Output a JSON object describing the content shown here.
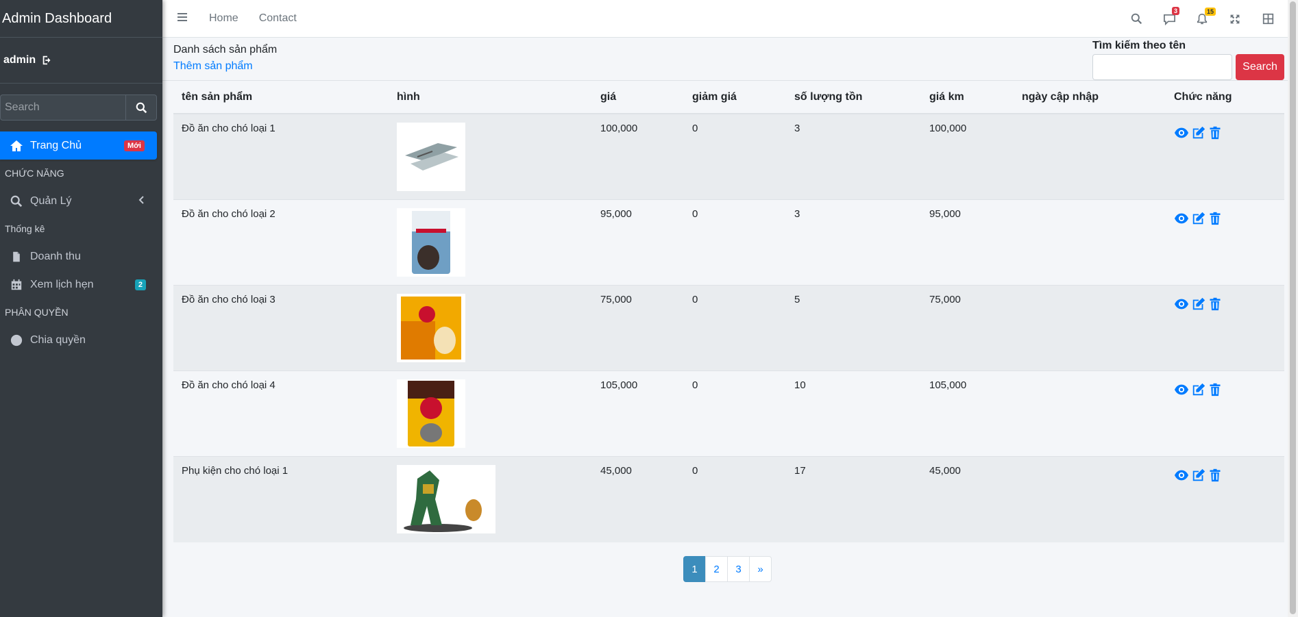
{
  "brand": "Admin Dashboard",
  "user": "admin",
  "sidebar_search_placeholder": "Search",
  "nav": {
    "home": "Trang Chủ",
    "home_badge": "Mới",
    "header_functions": "CHỨC NĂNG",
    "manage": "Quản Lý",
    "header_stats": "Thống kê",
    "revenue": "Doanh thu",
    "appointments": "Xem lịch hẹn",
    "appointments_badge": "2",
    "header_perm": "PHÂN QUYỀN",
    "perm": "Chia quyền"
  },
  "topnav": {
    "home": "Home",
    "contact": "Contact",
    "messages_count": "3",
    "notifications_count": "15"
  },
  "page": {
    "title": "Danh sách sản phẩm",
    "add_link": "Thêm sản phẩm",
    "search_label": "Tìm kiếm theo tên",
    "search_button": "Search"
  },
  "table": {
    "headers": [
      "tên sản phẩm",
      "hình",
      "giá",
      "giảm giá",
      "số lượng tồn",
      "giá km",
      "ngày cập nhập",
      "Chức năng"
    ],
    "rows": [
      {
        "name": "Đồ ăn cho chó loại 1",
        "price": "100,000",
        "discount": "0",
        "stock": "3",
        "sale_price": "100,000",
        "updated": ""
      },
      {
        "name": "Đồ ăn cho chó loại 2",
        "price": "95,000",
        "discount": "0",
        "stock": "3",
        "sale_price": "95,000",
        "updated": ""
      },
      {
        "name": "Đồ ăn cho chó loại 3",
        "price": "75,000",
        "discount": "0",
        "stock": "5",
        "sale_price": "75,000",
        "updated": ""
      },
      {
        "name": "Đồ ăn cho chó loại 4",
        "price": "105,000",
        "discount": "0",
        "stock": "10",
        "sale_price": "105,000",
        "updated": ""
      },
      {
        "name": "Phụ kiện cho chó loại 1",
        "price": "45,000",
        "discount": "0",
        "stock": "17",
        "sale_price": "45,000",
        "updated": ""
      }
    ]
  },
  "pagination": [
    "1",
    "2",
    "3",
    "»"
  ],
  "colors": {
    "sidebar": "#343a40",
    "primary": "#007bff",
    "danger": "#dc3545",
    "page_active": "#3c8dbc"
  }
}
